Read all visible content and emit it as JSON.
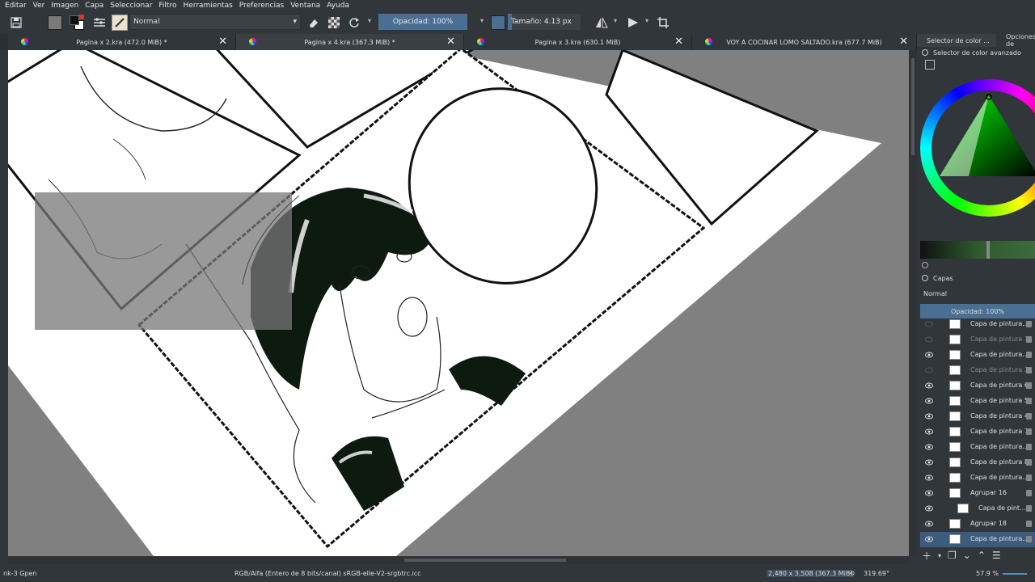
{
  "menu": [
    "Editar",
    "Ver",
    "Imagen",
    "Capa",
    "Seleccionar",
    "Filtro",
    "Herramientas",
    "Preferencias",
    "Ventana",
    "Ayuda"
  ],
  "toolbar": {
    "blend_mode": "Normal",
    "opacity_label": "Opacidad: 100%",
    "opacity_value": 1.0,
    "size_label": "Tamaño: 4.13 px",
    "size_value_fraction": 0.05
  },
  "tabs": [
    {
      "title": "Pagina x 2.kra (472.0 MiB) *"
    },
    {
      "title": "Pagina x 4.kra (367.3 MiB) *"
    },
    {
      "title": "Pagina x 3.kra (630.1 MiB)"
    },
    {
      "title": "VOY A COCINAR LOMO SALTADO.kra (677.7 MiB)"
    }
  ],
  "dock": {
    "tab1": "Selector de color ...",
    "tab2": "Opciones de",
    "color_header": "Selector de color avanzado",
    "layers_title": "Capas",
    "layers_blend": "Normal",
    "layers_opacity": "Opacidad: 100%",
    "layers": [
      {
        "name": "Capa de pintura...",
        "visible": false,
        "dim": false,
        "selected": false,
        "group": false
      },
      {
        "name": "Capa de pintura 1",
        "visible": false,
        "dim": true,
        "selected": false,
        "group": false
      },
      {
        "name": "Capa de pintura...",
        "visible": true,
        "dim": false,
        "selected": false,
        "group": false
      },
      {
        "name": "Capa de pintura 3",
        "visible": false,
        "dim": true,
        "selected": false,
        "group": false
      },
      {
        "name": "Capa de pintura 6",
        "visible": true,
        "dim": false,
        "selected": false,
        "group": false
      },
      {
        "name": "Capa de pintura 5",
        "visible": true,
        "dim": false,
        "selected": false,
        "group": false
      },
      {
        "name": "Capa de pintura 4",
        "visible": true,
        "dim": false,
        "selected": false,
        "group": false
      },
      {
        "name": "Capa de pintura 7",
        "visible": true,
        "dim": false,
        "selected": false,
        "group": false
      },
      {
        "name": "Capa de pintura...",
        "visible": true,
        "dim": false,
        "selected": false,
        "group": false
      },
      {
        "name": "Capa de pintura 8",
        "visible": true,
        "dim": false,
        "selected": false,
        "group": false
      },
      {
        "name": "Capa de pintura...",
        "visible": true,
        "dim": false,
        "selected": false,
        "group": false
      },
      {
        "name": "Agrupar 16",
        "visible": true,
        "dim": false,
        "selected": false,
        "group": true
      },
      {
        "name": "Capa de pint...",
        "visible": true,
        "dim": false,
        "selected": false,
        "group": false,
        "indent": true
      },
      {
        "name": "Agrupar 18",
        "visible": true,
        "dim": false,
        "selected": false,
        "group": true
      },
      {
        "name": "Capa de pintura...",
        "visible": true,
        "dim": false,
        "selected": true,
        "group": false
      }
    ]
  },
  "status": {
    "left": "nk-3 Gpen",
    "color_profile": "RGB/Alfa (Entero de 8 bits/canal)  sRGB-elle-V2-srgbtrc.icc",
    "dimensions": "2,480 x 3,508 (367.3 MiB)",
    "rotation": "319.69°",
    "zoom": "57.9 %"
  },
  "colors": {
    "bg": "#31363b",
    "accent": "#4a6f93",
    "canvas_bg": "#808080"
  }
}
